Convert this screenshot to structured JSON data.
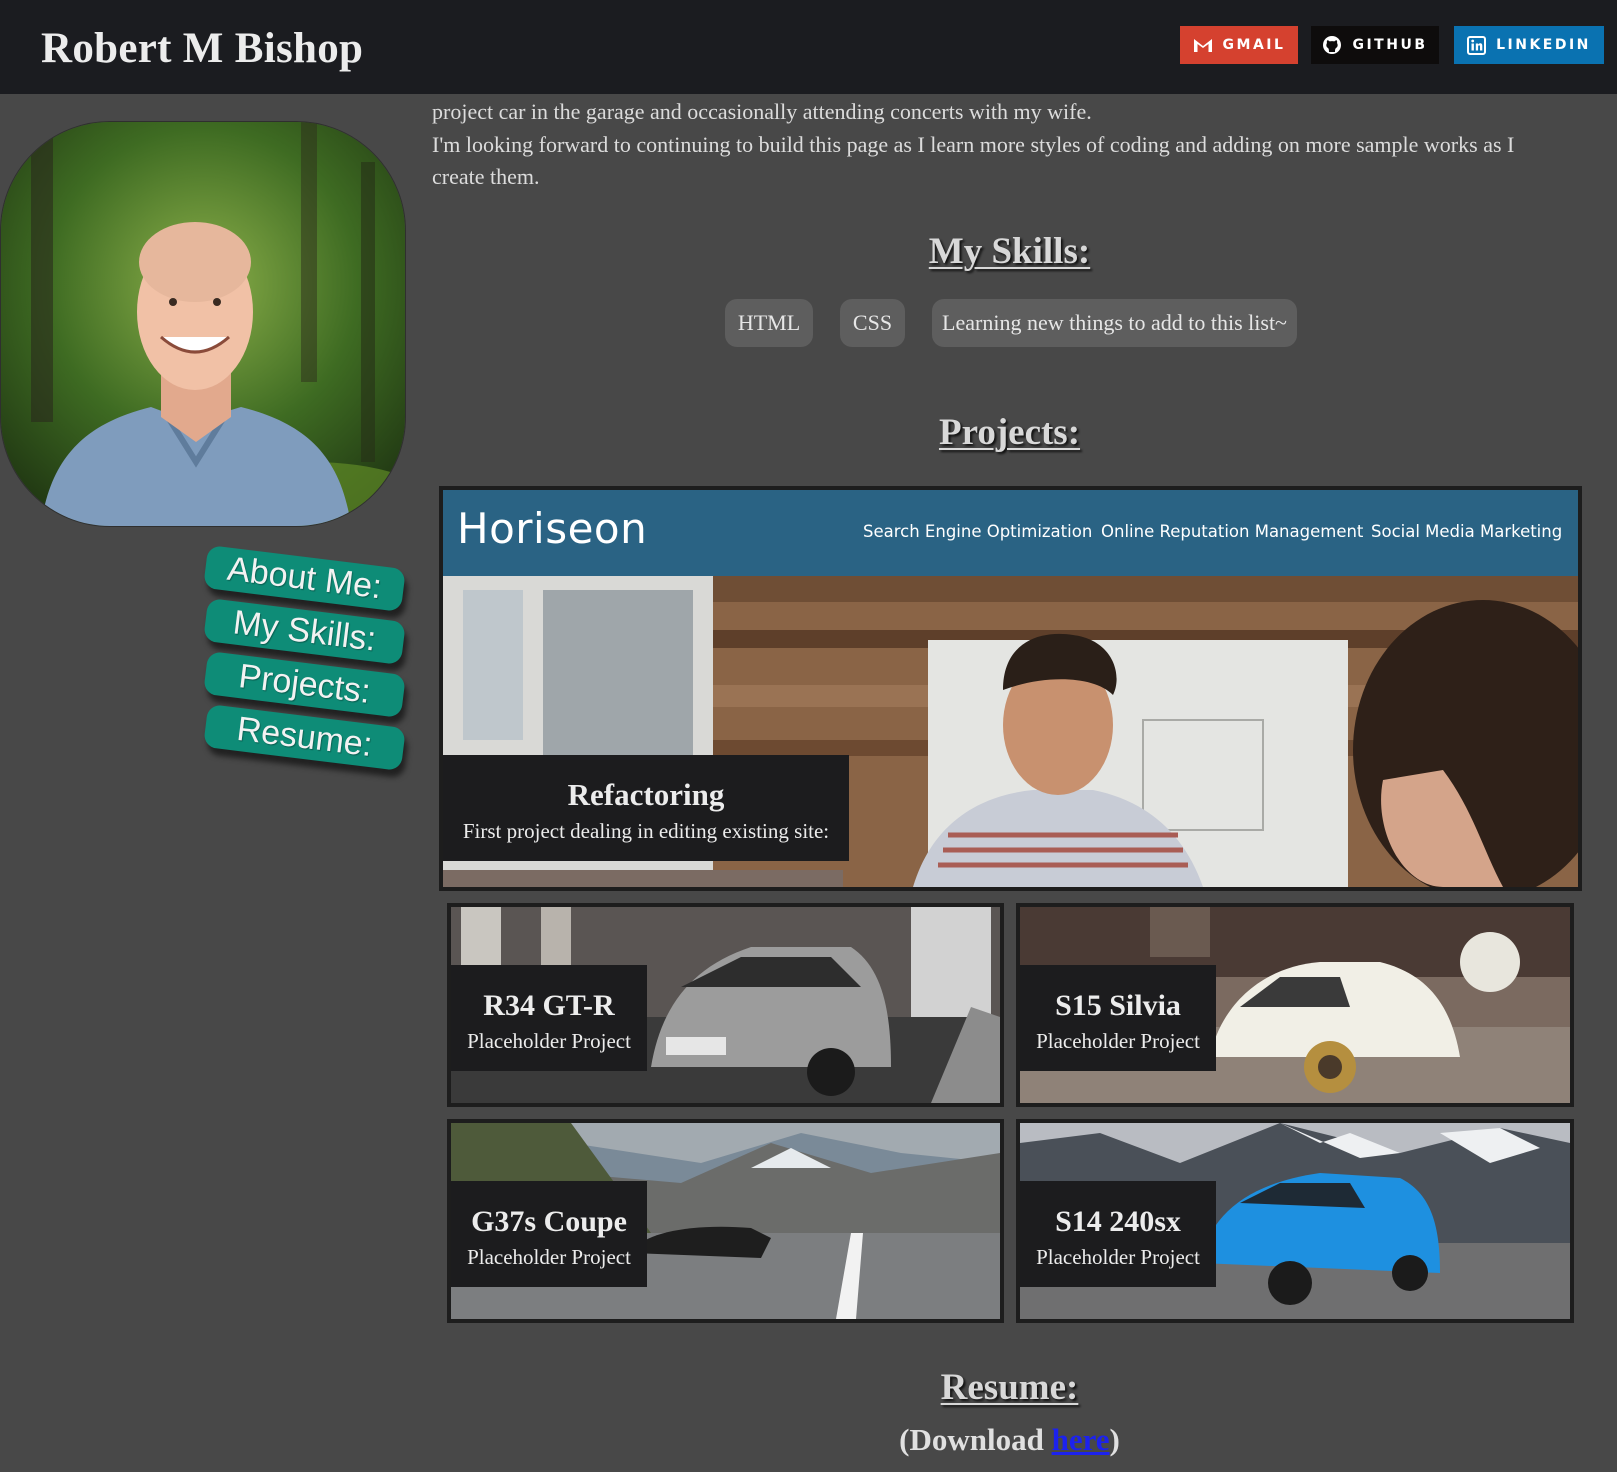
{
  "header": {
    "name": "Robert M Bishop",
    "links": {
      "gmail": "GMAIL",
      "github": "GITHUB",
      "linkedin": "LINKEDIN"
    },
    "colors": {
      "gmail": "#d5412f",
      "github": "#0e0c0c",
      "linkedin": "#0a72b1"
    }
  },
  "sidebar": {
    "nav": [
      "About Me:",
      "My Skills:",
      "Projects:",
      "Resume:"
    ],
    "accent": "#0e8c77"
  },
  "about": {
    "line1": "project car in the garage and occasionally attending concerts with my wife.",
    "line2": "I'm looking forward to continuing to build this page as I learn more styles of coding and adding on more sample works as I create them."
  },
  "skills": {
    "heading": "My Skills:",
    "items": [
      "HTML",
      "CSS",
      "Learning new things to add to this list~"
    ]
  },
  "projects": {
    "heading": "Projects:",
    "featured": {
      "title": "Refactoring",
      "subtitle": "First project dealing in editing existing site:",
      "site_logo": "Horiseon",
      "site_nav": [
        "Search Engine Optimization",
        "Online Reputation Management",
        "Social Media Marketing"
      ]
    },
    "cards": [
      {
        "title": "R34 GT-R",
        "subtitle": "Placeholder Project"
      },
      {
        "title": "S15 Silvia",
        "subtitle": "Placeholder Project"
      },
      {
        "title": "G37s Coupe",
        "subtitle": "Placeholder Project"
      },
      {
        "title": "S14 240sx",
        "subtitle": "Placeholder Project"
      }
    ]
  },
  "resume": {
    "heading": "Resume:",
    "download_prefix": "(Download ",
    "download_link": "here",
    "download_suffix": ")"
  }
}
